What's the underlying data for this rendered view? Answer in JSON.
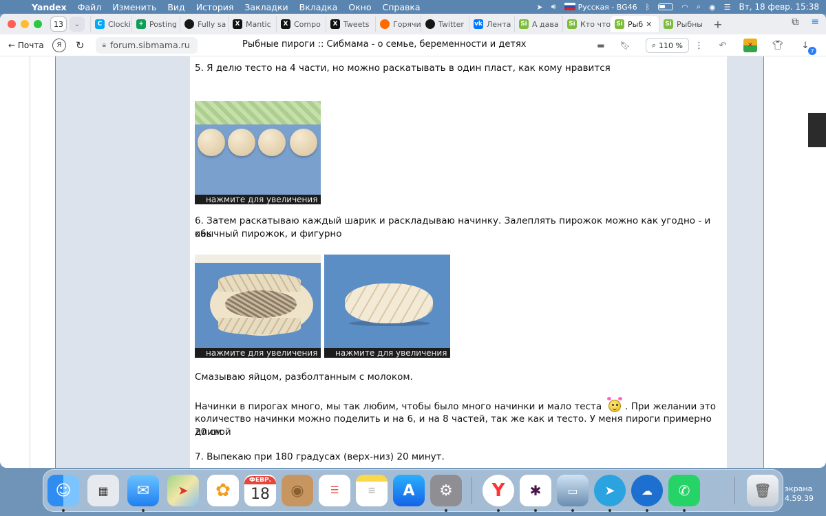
{
  "menubar": {
    "app": "Yandex",
    "items": [
      "Файл",
      "Изменить",
      "Вид",
      "История",
      "Закладки",
      "Вкладка",
      "Окно",
      "Справка"
    ],
    "input_source": "Русская - BG46",
    "datetime": "Вт, 18 февр.  15:38"
  },
  "tabs": {
    "count": "13",
    "items": [
      {
        "label": "Clockify",
        "icon": "clockify-icon"
      },
      {
        "label": "Posting",
        "icon": "sheets-icon"
      },
      {
        "label": "Fully sa",
        "icon": "github-icon"
      },
      {
        "label": "Mantic",
        "icon": "x-icon"
      },
      {
        "label": "Compo",
        "icon": "x-icon"
      },
      {
        "label": "Tweets",
        "icon": "x-icon"
      },
      {
        "label": "Горячи",
        "icon": "fire-icon"
      },
      {
        "label": "Twitter",
        "icon": "github-icon"
      },
      {
        "label": "Лента",
        "icon": "vk-icon"
      },
      {
        "label": "А дава",
        "icon": "sibmama-icon"
      },
      {
        "label": "Кто что",
        "icon": "sibmama-icon"
      },
      {
        "label": "Рыб",
        "icon": "sibmama-icon",
        "active": true
      },
      {
        "label": "Рыбны",
        "icon": "sibmama-icon"
      }
    ]
  },
  "address": {
    "back_label": "Почта",
    "url": "forum.sibmama.ru",
    "page_title": "Рыбные пироги :: Сибмама - о семье, беременности и детях",
    "zoom": "110 %"
  },
  "post": {
    "step5": "5. Я делю тесто на 4 части, но можно раскатывать в один пласт, как кому нравится",
    "caption": "нажмите для увеличения",
    "step6_line1": "6. Затем раскатываю каждый шарик и раскладываю начинку. Залеплять пирожок можно как угодно - и как",
    "step6_line2": "обычный пирожок, и фигурно",
    "egg": "Смазываю яйцом, разболтанным с молоком.",
    "filling_a": "Начинки в пирогах много, мы так любим, чтобы было много начинки и мало теста",
    "filling_b": ". При желании это",
    "filling_line2": "количество начинки можно поделить и на 6, и на 8 частей, так же как и тесто. У меня пироги примерно 20 см",
    "filling_line3": "длиной",
    "step7": "7. Выпекаю при 180 градусах (верх-низ) 20 минут."
  },
  "dock": {
    "calendar_month": "ФЕВР.",
    "calendar_day": "18",
    "right_label_1": "экрана",
    "right_label_2": "4.59.39",
    "apps": [
      "finder-icon",
      "launchpad-icon",
      "mail-icon",
      "maps-icon",
      "photos-icon",
      "calendar-icon",
      "contacts-icon",
      "reminders-icon",
      "notes-icon",
      "appstore-icon",
      "settings-icon",
      "yandex-browser-icon",
      "slack-icon",
      "preview-icon",
      "telegram-icon",
      "openoffice-icon",
      "whatsapp-icon",
      "trash-icon"
    ]
  }
}
